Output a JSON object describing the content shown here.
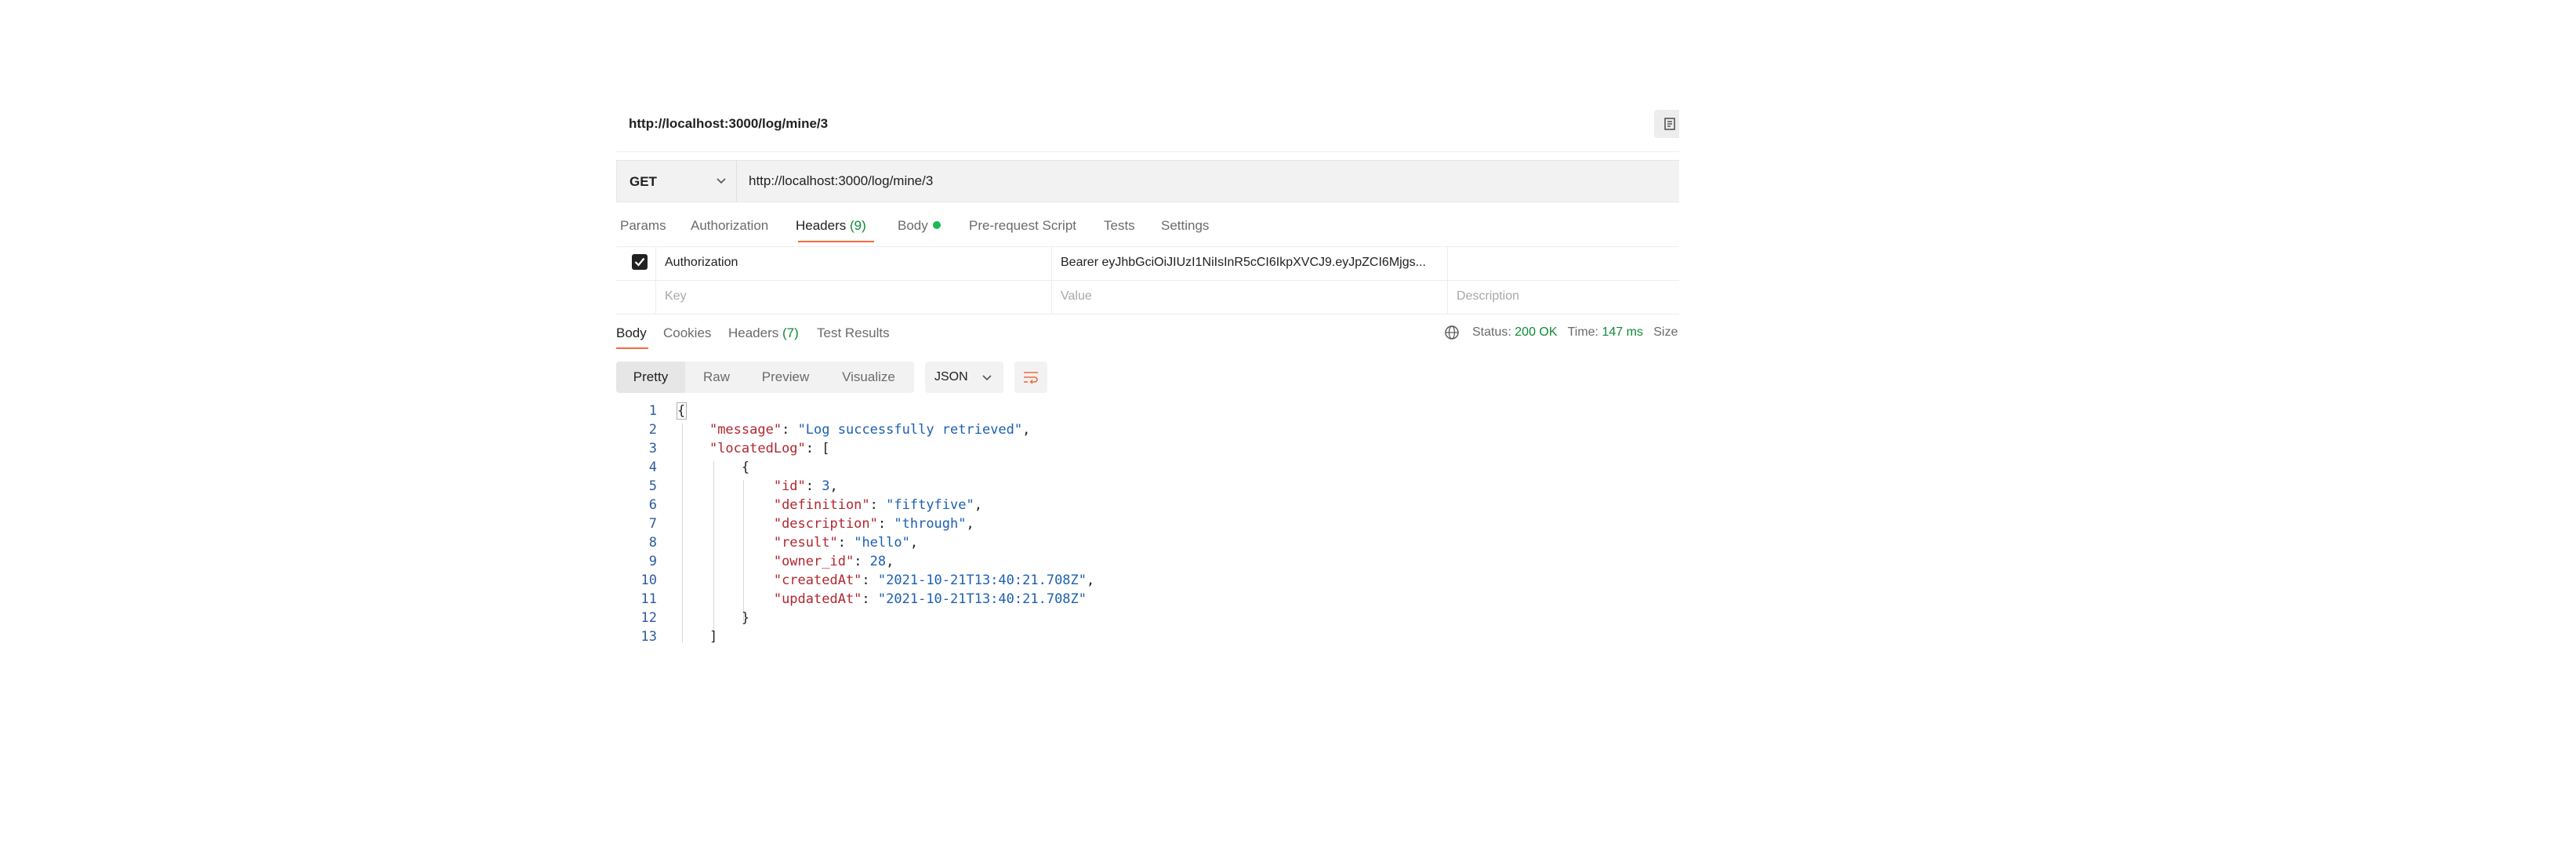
{
  "title": "http://localhost:3000/log/mine/3",
  "request": {
    "method": "GET",
    "url": "http://localhost:3000/log/mine/3"
  },
  "request_tabs": {
    "params": "Params",
    "authorization": "Authorization",
    "headers": "Headers",
    "headers_count": "(9)",
    "body": "Body",
    "pre_request": "Pre-request Script",
    "tests": "Tests",
    "settings": "Settings"
  },
  "headers_table": {
    "row": {
      "key": "Authorization",
      "value": "Bearer eyJhbGciOiJIUzI1NiIsInR5cCI6IkpXVCJ9.eyJpZCI6Mjgs...",
      "checked": true
    },
    "placeholder": {
      "key": "Key",
      "value": "Value",
      "description": "Description"
    }
  },
  "response_tabs": {
    "body": "Body",
    "cookies": "Cookies",
    "headers": "Headers",
    "headers_count": "(7)",
    "test_results": "Test Results"
  },
  "status": {
    "status_label": "Status:",
    "status_value": "200 OK",
    "time_label": "Time:",
    "time_value": "147 ms",
    "size_label": "Size"
  },
  "view_modes": {
    "pretty": "Pretty",
    "raw": "Raw",
    "preview": "Preview",
    "visualize": "Visualize"
  },
  "format": "JSON",
  "code_lines": {
    "n1": "1",
    "n2": "2",
    "n3": "3",
    "n4": "4",
    "n5": "5",
    "n6": "6",
    "n7": "7",
    "n8": "8",
    "n9": "9",
    "n10": "10",
    "n11": "11",
    "n12": "12",
    "n13": "13",
    "open_brace": "{",
    "k_message": "\"message\"",
    "v_message": "\"Log successfully retrieved\"",
    "k_locatedLog": "\"locatedLog\"",
    "open_bracket": "[",
    "k_id": "\"id\"",
    "v_id": "3",
    "k_definition": "\"definition\"",
    "v_definition": "\"fiftyfive\"",
    "k_description": "\"description\"",
    "v_description": "\"through\"",
    "k_result": "\"result\"",
    "v_result": "\"hello\"",
    "k_owner_id": "\"owner_id\"",
    "v_owner_id": "28",
    "k_createdAt": "\"createdAt\"",
    "v_createdAt": "\"2021-10-21T13:40:21.708Z\"",
    "k_updatedAt": "\"updatedAt\"",
    "v_updatedAt": "\"2021-10-21T13:40:21.708Z\"",
    "close_brace": "}",
    "close_bracket": "]"
  },
  "colors": {
    "accent": "#f26b3a",
    "success": "#0f8a38",
    "json_key": "#b0272e",
    "json_value": "#1c5fb0"
  },
  "icons": [
    "documentation-icon",
    "chevron-down-icon",
    "checkbox-checked-icon",
    "globe-icon",
    "wrap-lines-icon"
  ]
}
